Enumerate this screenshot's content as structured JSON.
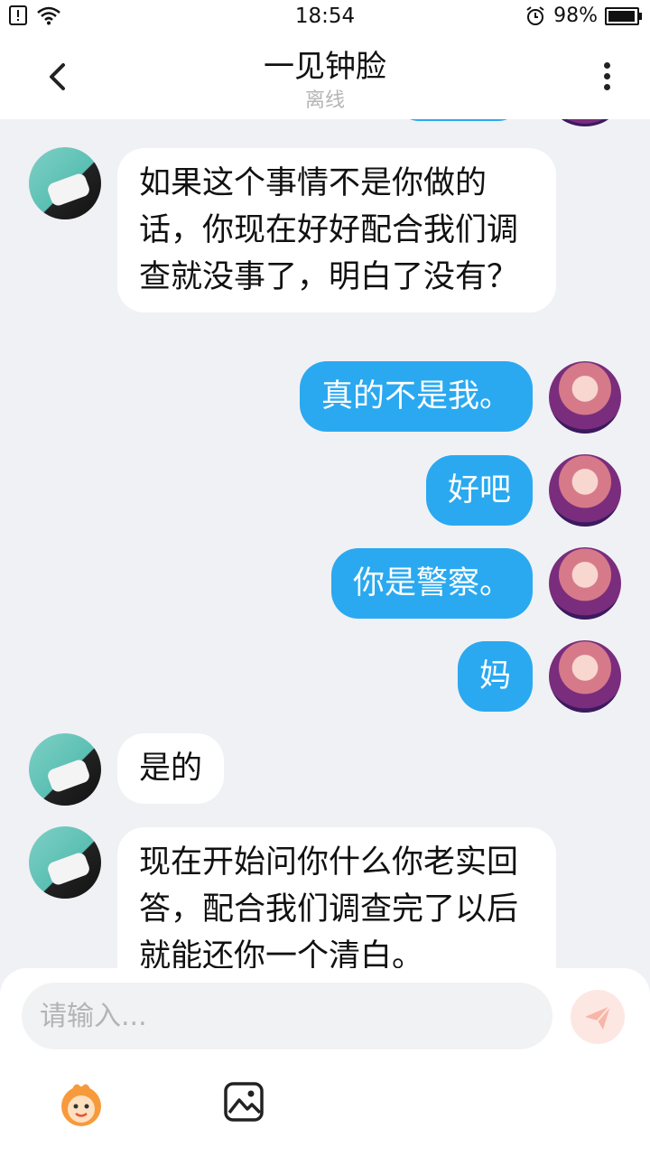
{
  "status_bar": {
    "time": "18:54",
    "battery": "98%",
    "battery_level": 0.98,
    "icons": [
      "sim-alert-icon",
      "wifi-icon",
      "alarm-icon",
      "battery-icon"
    ]
  },
  "header": {
    "title": "一见钟脸",
    "subtitle": "离线",
    "back_icon": "chevron-left-icon",
    "more_icon": "more-vertical-icon"
  },
  "messages": [
    {
      "side": "left",
      "text": "如果这个事情不是你做的话，你现在好好配合我们调查就没事了，明白了没有？"
    },
    {
      "side": "right",
      "text": "真的不是我。"
    },
    {
      "side": "right",
      "text": "好吧"
    },
    {
      "side": "right",
      "text": "你是警察。"
    },
    {
      "side": "right",
      "text": "妈"
    },
    {
      "side": "left",
      "text": "是的"
    },
    {
      "side": "left",
      "text": "现在开始问你什么你老实回答，配合我们调查完了以后就能还你一个清白。"
    }
  ],
  "composer": {
    "placeholder": "请输入...",
    "send_icon": "send-icon",
    "emoji_icon": "emoji-icon",
    "image_icon": "image-icon"
  },
  "colors": {
    "outgoing_bubble": "#2aa9f0",
    "incoming_bubble": "#ffffff",
    "background": "#f0f1f5",
    "send_button": "#fde7e3"
  }
}
